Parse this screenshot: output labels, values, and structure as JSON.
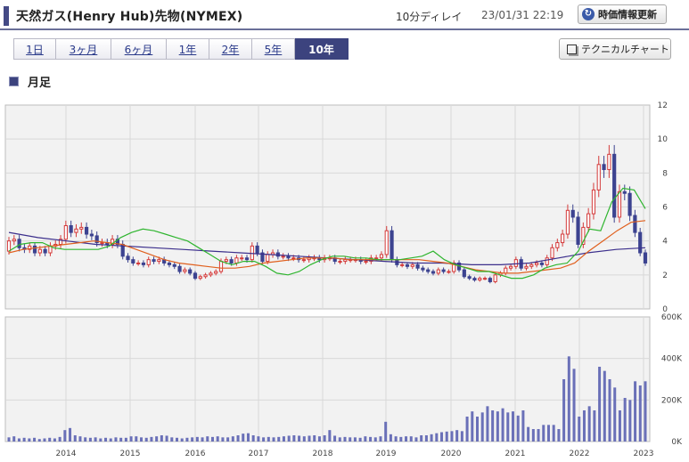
{
  "header": {
    "title": "天然ガス(Henry Hub)先物(NYMEX)",
    "delay": "10分ディレイ",
    "datetime": "23/01/31 22:19",
    "refresh_label": "時価情報更新"
  },
  "tabs": [
    {
      "label": "1日",
      "active": false
    },
    {
      "label": "3ヶ月",
      "active": false
    },
    {
      "label": "6ヶ月",
      "active": false
    },
    {
      "label": "1年",
      "active": false
    },
    {
      "label": "2年",
      "active": false
    },
    {
      "label": "5年",
      "active": false
    },
    {
      "label": "10年",
      "active": true
    }
  ],
  "tech_chart_label": "テクニカルチャート",
  "section_title": "月足",
  "colors": {
    "up": "#d43a3a",
    "down": "#3c4390",
    "ma_short": "#2fb52f",
    "ma_mid": "#e0601e",
    "ma_long": "#3c2f8c",
    "volume": "#6a70b8",
    "header_accent": "#444a85"
  },
  "chart_data": {
    "type": "candlestick",
    "x_ticks": [
      "2014",
      "2015",
      "2016",
      "2017",
      "2018",
      "2019",
      "2020",
      "2021",
      "2022",
      "2023"
    ],
    "x_range": [
      "2013-04",
      "2023-02"
    ],
    "price_axis": {
      "ticks": [
        0,
        2,
        4,
        6,
        8,
        10,
        12
      ],
      "range": [
        0,
        12
      ],
      "side": "right"
    },
    "volume_axis": {
      "ticks": [
        "0K",
        "200K",
        "400K",
        "600K"
      ],
      "range": [
        0,
        600
      ],
      "unit": "K",
      "side": "right"
    },
    "grid": true,
    "candles_open": [
      3.4,
      4.0,
      4.1,
      3.6,
      3.5,
      3.7,
      3.3,
      3.5,
      3.3,
      3.7,
      3.8,
      4.1,
      4.9,
      4.5,
      4.7,
      4.8,
      4.4,
      4.3,
      3.9,
      3.9,
      3.8,
      4.1,
      3.8,
      3.1,
      2.9,
      2.7,
      2.7,
      2.6,
      2.9,
      2.8,
      2.9,
      2.7,
      2.6,
      2.5,
      2.2,
      2.3,
      2.1,
      1.8,
      1.9,
      2.0,
      2.1,
      2.2,
      2.8,
      2.9,
      2.7,
      3.0,
      3.0,
      2.9,
      3.7,
      3.3,
      2.8,
      3.2,
      3.3,
      3.1,
      3.1,
      3.0,
      3.0,
      2.9,
      2.9,
      3.0,
      3.0,
      2.9,
      3.0,
      3.0,
      2.8,
      2.8,
      2.9,
      2.9,
      2.9,
      2.8,
      2.8,
      3.0,
      3.0,
      3.2,
      4.6,
      2.9,
      2.6,
      2.6,
      2.5,
      2.6,
      2.4,
      2.3,
      2.2,
      2.1,
      2.3,
      2.2,
      2.2,
      2.7,
      2.3,
      1.9,
      1.8,
      1.7,
      1.8,
      1.8,
      1.6,
      2.0,
      2.1,
      2.4,
      2.5,
      2.9,
      2.4,
      2.5,
      2.6,
      2.7,
      2.6,
      3.0,
      3.6,
      3.9,
      4.4,
      5.8,
      5.4,
      3.8,
      4.8,
      5.6,
      7.0,
      8.5,
      8.2,
      9.1,
      5.4,
      6.9,
      6.8,
      5.5,
      4.5,
      3.3
    ],
    "candles_close": [
      4.0,
      4.1,
      3.6,
      3.5,
      3.7,
      3.3,
      3.5,
      3.3,
      3.7,
      3.8,
      4.1,
      4.9,
      4.5,
      4.7,
      4.8,
      4.4,
      4.3,
      3.9,
      3.9,
      3.8,
      4.1,
      3.8,
      3.1,
      2.9,
      2.7,
      2.7,
      2.6,
      2.9,
      2.8,
      2.9,
      2.7,
      2.6,
      2.5,
      2.2,
      2.3,
      2.1,
      1.8,
      1.9,
      2.0,
      2.1,
      2.2,
      2.8,
      2.9,
      2.7,
      3.0,
      3.0,
      2.9,
      3.7,
      3.3,
      2.8,
      3.2,
      3.3,
      3.1,
      3.1,
      3.0,
      3.0,
      2.9,
      2.9,
      3.0,
      3.0,
      2.9,
      3.0,
      3.0,
      2.8,
      2.8,
      2.9,
      2.9,
      2.9,
      2.8,
      2.8,
      3.0,
      3.0,
      3.2,
      4.6,
      2.9,
      2.6,
      2.6,
      2.5,
      2.6,
      2.4,
      2.3,
      2.2,
      2.1,
      2.3,
      2.2,
      2.2,
      2.7,
      2.3,
      1.9,
      1.8,
      1.7,
      1.8,
      1.8,
      1.6,
      2.0,
      2.1,
      2.4,
      2.5,
      2.9,
      2.4,
      2.5,
      2.6,
      2.7,
      2.6,
      3.0,
      3.6,
      3.9,
      4.4,
      5.8,
      5.4,
      3.8,
      4.8,
      5.6,
      7.0,
      8.5,
      8.2,
      9.1,
      5.4,
      6.9,
      6.8,
      5.5,
      4.5,
      3.3,
      2.7
    ],
    "ma_short_sample": [
      3.4,
      3.8,
      3.9,
      3.9,
      3.6,
      3.5,
      3.5,
      3.5,
      3.5,
      3.7,
      4.2,
      4.5,
      4.7,
      4.6,
      4.4,
      4.2,
      4.0,
      3.6,
      3.2,
      2.8,
      2.6,
      2.8,
      2.8,
      2.5,
      2.1,
      2.0,
      2.2,
      2.6,
      2.9,
      3.1,
      3.1,
      3.0,
      3.0,
      2.9,
      2.9,
      2.9,
      3.0,
      3.1,
      3.4,
      2.9,
      2.6,
      2.4,
      2.2,
      2.2,
      2.0,
      1.8,
      1.8,
      2.0,
      2.4,
      2.6,
      2.7,
      3.4,
      4.7,
      4.6,
      6.3,
      7.1,
      7.0,
      5.9
    ],
    "ma_mid_sample": [
      3.3,
      3.5,
      3.6,
      3.7,
      3.8,
      3.9,
      4.0,
      3.9,
      3.8,
      3.5,
      3.2,
      2.9,
      2.7,
      2.6,
      2.5,
      2.4,
      2.4,
      2.5,
      2.7,
      2.8,
      2.9,
      3.0,
      3.0,
      3.0,
      2.9,
      2.9,
      2.9,
      2.9,
      2.9,
      2.9,
      2.8,
      2.7,
      2.5,
      2.3,
      2.2,
      2.1,
      2.1,
      2.2,
      2.3,
      2.4,
      2.7,
      3.4,
      4.0,
      4.6,
      5.1,
      5.2
    ],
    "ma_long_sample": [
      4.5,
      4.2,
      4.0,
      3.8,
      3.7,
      3.6,
      3.5,
      3.4,
      3.3,
      3.2,
      3.1,
      3.0,
      2.9,
      2.8,
      2.7,
      2.7,
      2.6,
      2.6,
      2.7,
      3.0,
      3.3,
      3.5,
      3.6
    ],
    "volume_k": [
      20,
      25,
      15,
      18,
      15,
      18,
      12,
      15,
      18,
      15,
      22,
      55,
      65,
      30,
      25,
      20,
      18,
      20,
      15,
      18,
      15,
      20,
      18,
      18,
      25,
      25,
      20,
      18,
      22,
      25,
      30,
      28,
      20,
      18,
      15,
      18,
      20,
      22,
      20,
      25,
      22,
      25,
      20,
      20,
      25,
      30,
      38,
      40,
      30,
      25,
      20,
      22,
      20,
      22,
      25,
      28,
      30,
      28,
      25,
      28,
      30,
      25,
      30,
      55,
      28,
      20,
      22,
      20,
      20,
      18,
      25,
      22,
      20,
      25,
      95,
      35,
      25,
      22,
      25,
      25,
      20,
      30,
      30,
      35,
      40,
      45,
      48,
      50,
      55,
      50,
      120,
      145,
      120,
      140,
      170,
      150,
      145,
      160,
      140,
      145,
      125,
      150,
      70,
      60,
      60,
      80,
      80,
      80,
      60,
      300,
      410,
      350,
      120,
      150,
      170,
      150,
      360,
      340,
      300,
      260,
      150,
      210,
      200,
      290,
      270,
      290
    ],
    "xlabel": "",
    "ylabel": ""
  }
}
